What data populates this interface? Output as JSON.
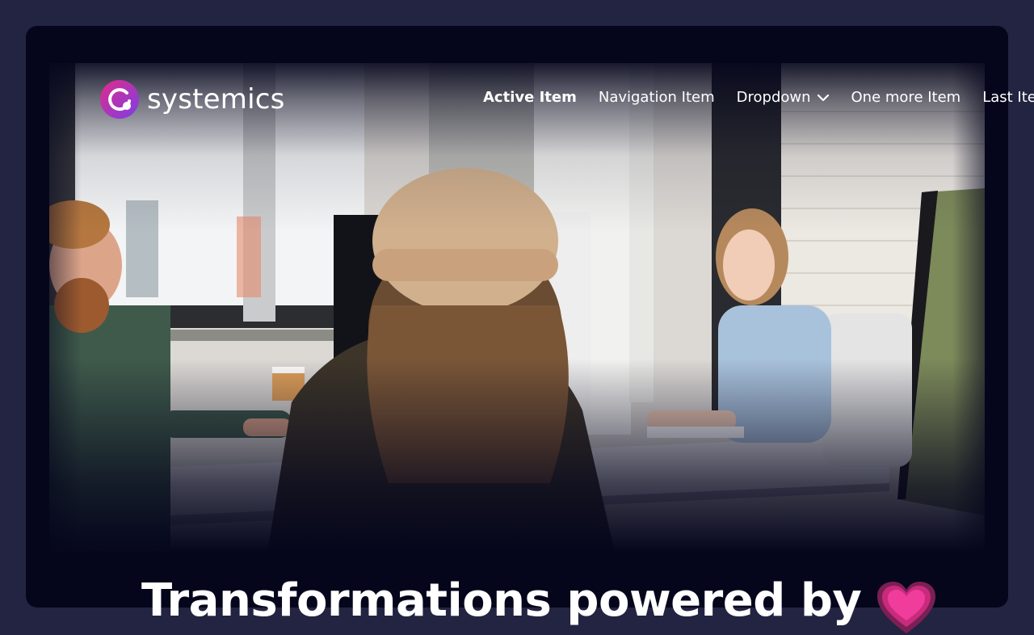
{
  "brand": {
    "name": "systemics",
    "logo_icon": "ring-logo-icon",
    "logo_gradient": [
      "#e12b88",
      "#7b3fe8"
    ]
  },
  "nav": {
    "items": [
      {
        "label": "Active Item",
        "active": true
      },
      {
        "label": "Navigation Item",
        "active": false
      },
      {
        "label": "Dropdown",
        "active": false,
        "icon": "chevron-down-icon"
      },
      {
        "label": "One more Item",
        "active": false
      },
      {
        "label": "Last Item",
        "active": false
      }
    ]
  },
  "hero": {
    "image": "office-team-photo",
    "headline": "Transformations powered by",
    "headline_icon": "heart-icon"
  },
  "colors": {
    "page_bg": "#232441",
    "frame_bg": "#05061c",
    "text": "#ffffff",
    "heart": "#f03c9a"
  }
}
